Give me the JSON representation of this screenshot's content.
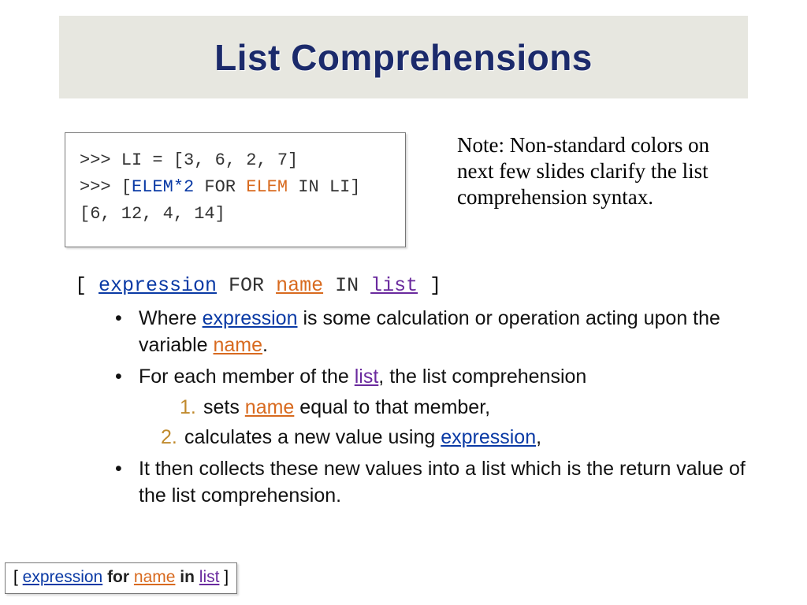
{
  "title": "List Comprehensions",
  "code": {
    "line1_pre": ">>> LI = [3, 6, 2, 7]",
    "line2_a": ">>> [",
    "line2_expr": "ELEM*2",
    "line2_b": " FOR ",
    "line2_name": "ELEM",
    "line2_c": " IN LI]",
    "line3": "[6, 12, 4, 14]"
  },
  "note": "Note: Non-standard colors on next few slides clarify the list comprehension syntax.",
  "syntax": {
    "open": "[ ",
    "expr": "expression",
    "for": " FOR ",
    "name": "name",
    "in": " IN ",
    "list": "list",
    "close": " ]"
  },
  "bullets": {
    "b1_a": "Where ",
    "b1_expr": "expression",
    "b1_b": " is some calculation or operation acting upon the variable ",
    "b1_name": "name",
    "b1_c": ".",
    "b2_a": "For each member of the ",
    "b2_list": "list",
    "b2_b": ", the list comprehension",
    "s1_a": "sets ",
    "s1_name": "name",
    "s1_b": " equal to that member,",
    "s2_a": "calculates a new value using ",
    "s2_expr": "expression",
    "s2_b": ",",
    "b3": "It then collects these new values into a list which is the return value of the list comprehension."
  },
  "footer": {
    "open": "[ ",
    "expr": "expression",
    "for": " for ",
    "name": "name",
    "in": " in ",
    "list": "list",
    "close": " ]"
  }
}
